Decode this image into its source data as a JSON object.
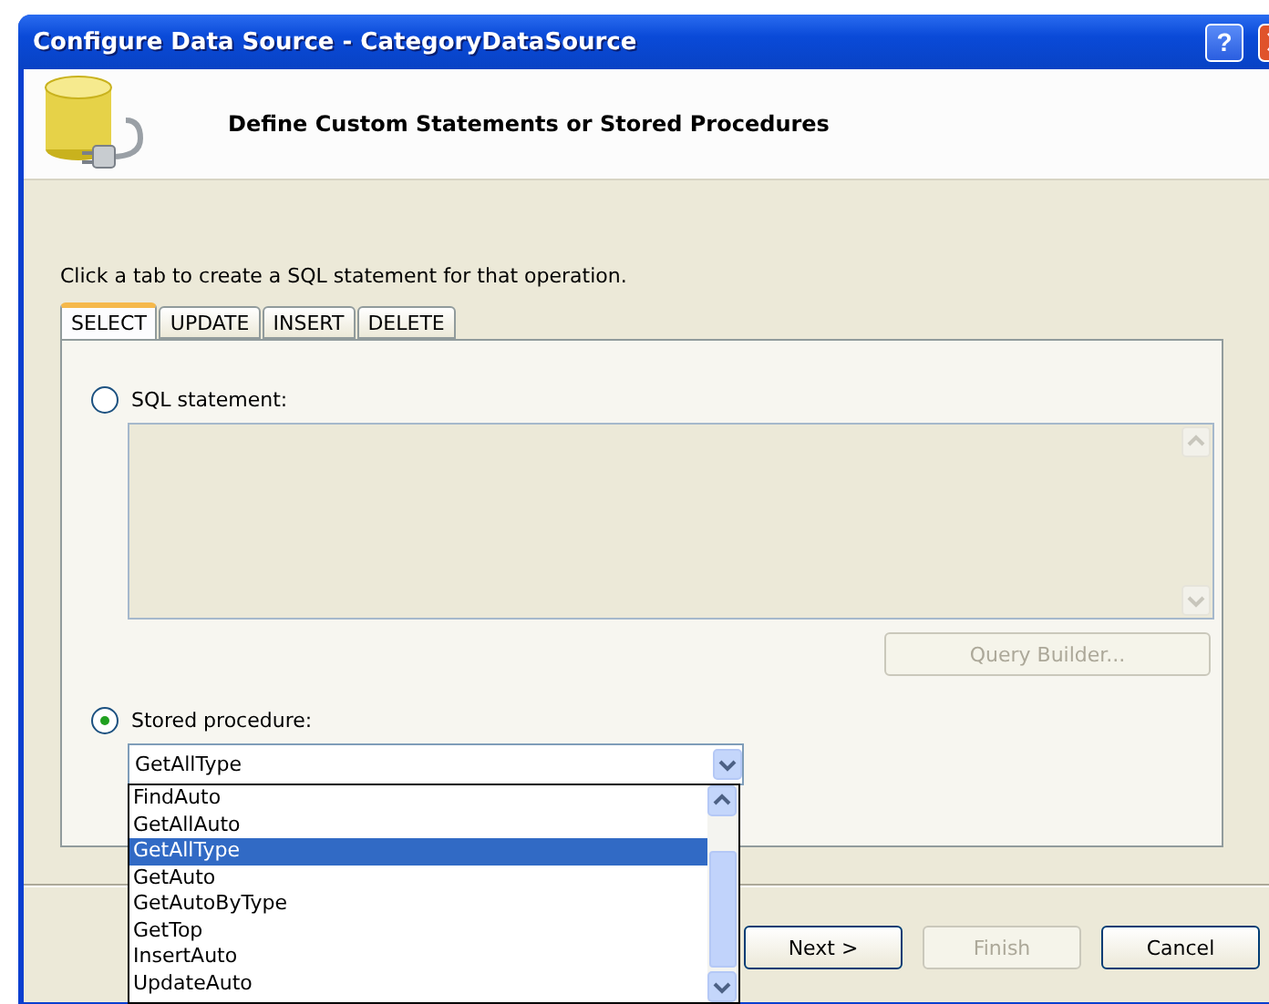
{
  "window": {
    "title": "Configure Data Source - CategoryDataSource",
    "help_button": "?"
  },
  "header": {
    "title": "Define Custom Statements or Stored Procedures"
  },
  "instruction": "Click a tab to create a SQL statement for that operation.",
  "tabs": [
    {
      "label": "SELECT",
      "selected": true
    },
    {
      "label": "UPDATE",
      "selected": false
    },
    {
      "label": "INSERT",
      "selected": false
    },
    {
      "label": "DELETE",
      "selected": false
    }
  ],
  "sql_statement": {
    "label": "SQL statement:",
    "selected": false
  },
  "query_builder": {
    "label": "Query Builder...",
    "disabled": true
  },
  "stored_procedure": {
    "label": "Stored procedure:",
    "selected": true,
    "value": "GetAllType"
  },
  "dropdown": {
    "expanded": true,
    "items": [
      {
        "label": "FindAuto",
        "selected": false
      },
      {
        "label": "GetAllAuto",
        "selected": false
      },
      {
        "label": "GetAllType",
        "selected": true
      },
      {
        "label": "GetAuto",
        "selected": false
      },
      {
        "label": "GetAutoByType",
        "selected": false
      },
      {
        "label": "GetTop",
        "selected": false
      },
      {
        "label": "InsertAuto",
        "selected": false
      },
      {
        "label": "UpdateAuto",
        "selected": false
      }
    ]
  },
  "buttons": [
    {
      "label": "Next >",
      "disabled": false
    },
    {
      "label": "Finish",
      "disabled": true
    },
    {
      "label": "Cancel",
      "disabled": false
    }
  ]
}
